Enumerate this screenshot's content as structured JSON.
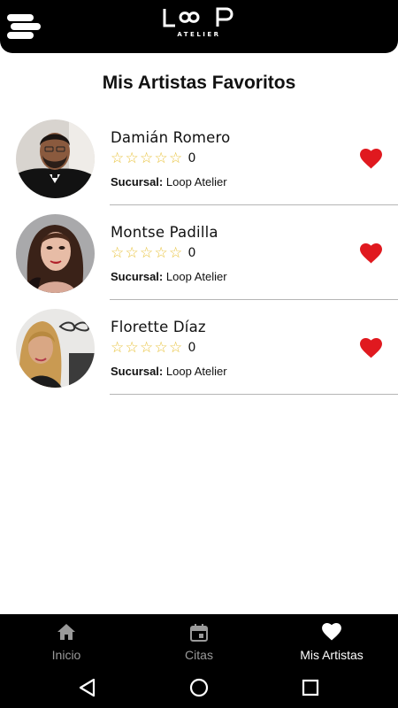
{
  "header": {
    "logo_text": "LOOP",
    "logo_sub": "ATELIER",
    "menu_icon": "menu-icon"
  },
  "page": {
    "title": "Mis Artistas Favoritos"
  },
  "artists": [
    {
      "name": "Damián Romero",
      "rating": 0,
      "max_rating": 5,
      "branch_label": "Sucursal:",
      "branch": "Loop Atelier",
      "favorite": true
    },
    {
      "name": "Montse Padilla",
      "rating": 0,
      "max_rating": 5,
      "branch_label": "Sucursal:",
      "branch": "Loop Atelier",
      "favorite": true
    },
    {
      "name": "Florette Díaz",
      "rating": 0,
      "max_rating": 5,
      "branch_label": "Sucursal:",
      "branch": "Loop Atelier",
      "favorite": true
    }
  ],
  "bottom_nav": {
    "items": [
      {
        "label": "Inicio",
        "icon": "home-icon",
        "active": false
      },
      {
        "label": "Citas",
        "icon": "calendar-icon",
        "active": false
      },
      {
        "label": "Mis Artistas",
        "icon": "heart-icon",
        "active": true
      }
    ]
  },
  "system_nav": [
    "back-icon",
    "home-circle-icon",
    "recents-icon"
  ],
  "colors": {
    "header_bg": "#000000",
    "heart": "#e0191f",
    "star_outline": "#e8c23a",
    "nav_active": "#ffffff",
    "nav_inactive": "#9a9a9a"
  }
}
